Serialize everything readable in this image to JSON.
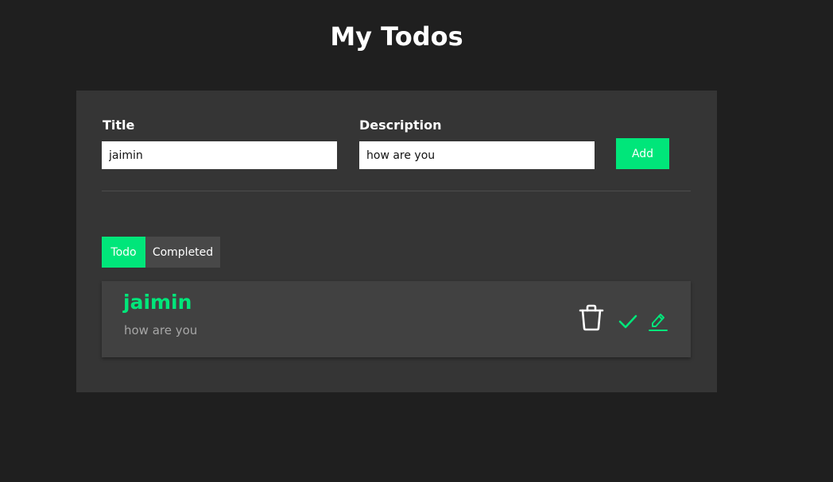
{
  "header": {
    "title": "My Todos"
  },
  "form": {
    "title_label": "Title",
    "title_value": "jaimin",
    "description_label": "Description",
    "description_value": "how are you",
    "add_label": "Add"
  },
  "tabs": [
    {
      "label": "Todo",
      "active": true
    },
    {
      "label": "Completed",
      "active": false
    }
  ],
  "todos": [
    {
      "title": "jaimin",
      "description": "how are you"
    }
  ],
  "icons": {
    "delete": "trash-icon",
    "complete": "check-icon",
    "edit": "pencil-icon"
  },
  "colors": {
    "accent": "#00e67a",
    "background": "#1f1f1f",
    "card": "#353535",
    "item": "#414141"
  }
}
